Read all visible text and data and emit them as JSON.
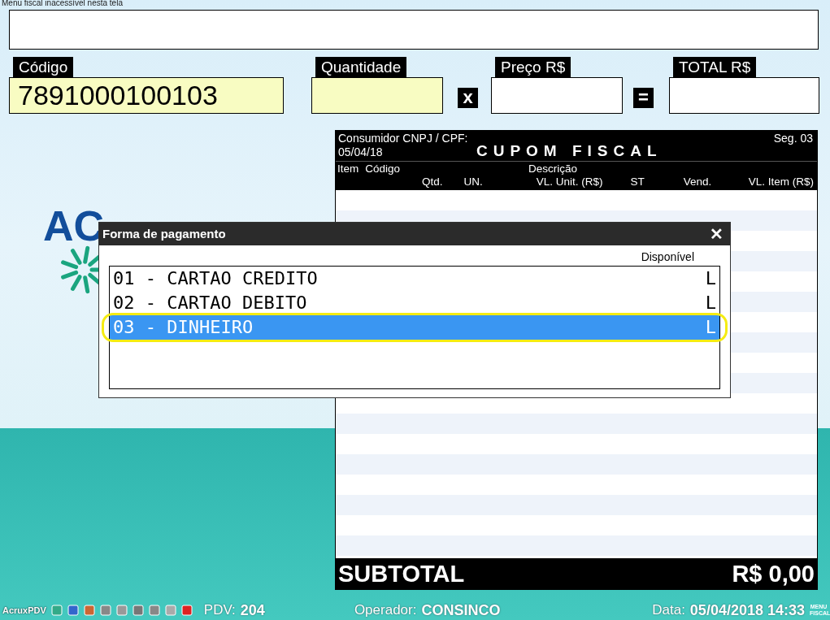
{
  "notice": "Menu fiscal inacessível nesta tela",
  "fields": [
    {
      "label": "Código",
      "value": "7891000100103",
      "kind": "input"
    },
    {
      "label": "Quantidade",
      "kind": "input"
    },
    {
      "label": "Preço R$",
      "kind": "output"
    },
    {
      "label": "TOTAL R$",
      "kind": "output"
    }
  ],
  "operators": [
    "x",
    "="
  ],
  "logo": {
    "text": "AC"
  },
  "receipt": {
    "consumer": "Consumidor CNPJ / CPF:",
    "date": "05/04/18",
    "title": "CUPOM FISCAL",
    "sequence": "Seg. 03",
    "columns_top": [
      "Item",
      "Código",
      "Descrição"
    ],
    "columns_bottom": [
      "Qtd.",
      "UN.",
      "VL. Unit. (R$)",
      "ST",
      "Vend.",
      "VL. Item (R$)"
    ],
    "subtotal_label": "SUBTOTAL",
    "subtotal": "R$ 0,00"
  },
  "dialog": {
    "title": "Forma de pagamento",
    "close": "✕",
    "column": "Disponível",
    "items": [
      {
        "label": "01 - CARTAO CREDITO",
        "available": "L",
        "selected": false,
        "highlighted": false
      },
      {
        "label": "02 - CARTAO DEBITO",
        "available": "L",
        "selected": false,
        "highlighted": false
      },
      {
        "label": "03 - DINHEIRO",
        "available": "L",
        "selected": true,
        "highlighted": true
      }
    ]
  },
  "status_bar": {
    "app": "AcruxPDV",
    "pdv_label": "PDV:",
    "pdv": "204",
    "operator_label": "Operador:",
    "operator": "CONSINCO",
    "date_label": "Data:",
    "date": "05/04/2018 14:33",
    "menu": "MENU FISCAL"
  }
}
